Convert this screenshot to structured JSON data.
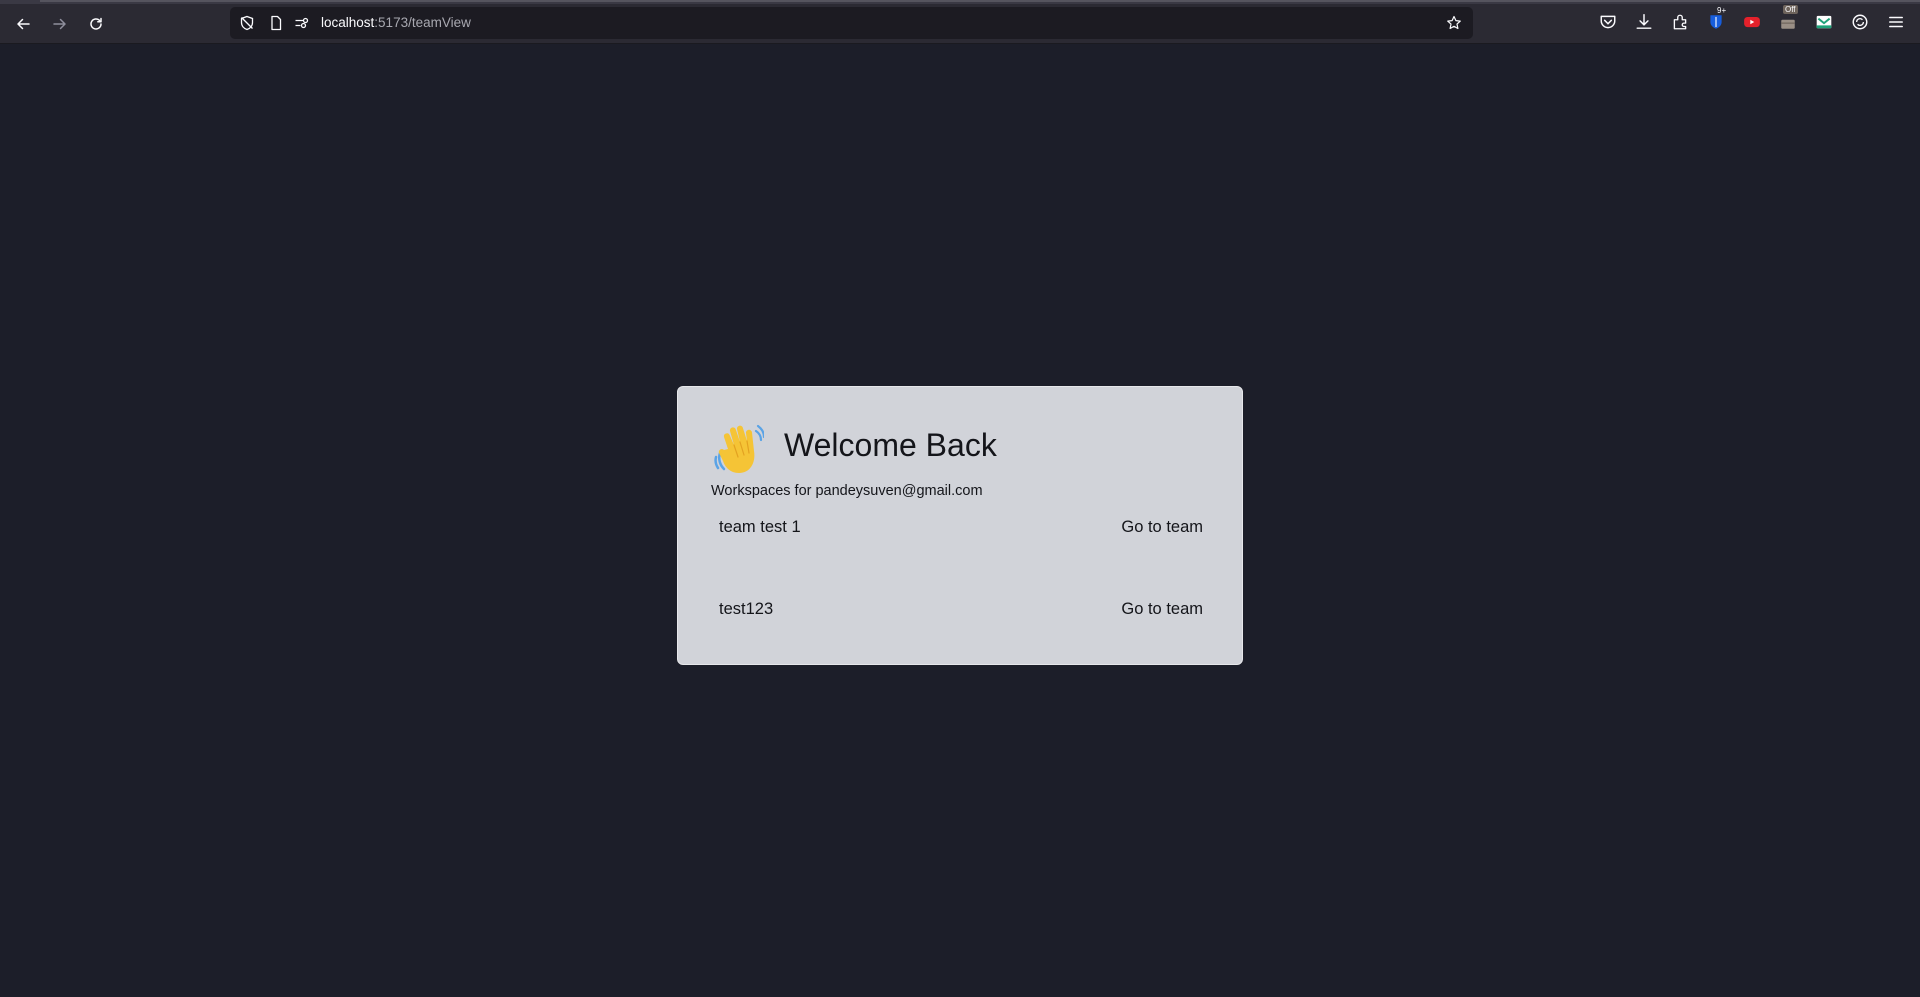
{
  "browser": {
    "url_host": "localhost",
    "url_path": ":5173/teamView",
    "icons": [
      "back-icon",
      "forward-icon",
      "reload-icon",
      "tracking-protection-icon",
      "page-info-icon",
      "permissions-icon",
      "bookmark-star-icon",
      "pocket-icon",
      "downloads-icon",
      "extensions-icon",
      "bitwarden-icon",
      "youtube-extension-icon",
      "extension-off-icon",
      "mail-extension-icon",
      "sync-icon",
      "menu-icon"
    ],
    "badges": {
      "bitwarden": "9+",
      "extension_off": "Off"
    }
  },
  "card": {
    "title": "Welcome Back",
    "subtitle": "Workspaces for pandeysuven@gmail.com",
    "teams": [
      {
        "name": "team test 1",
        "action": "Go to team"
      },
      {
        "name": "test123",
        "action": "Go to team"
      }
    ]
  },
  "colors": {
    "page_bg": "#1c1e29",
    "card_bg": "#d1d3d9",
    "chrome_bg": "#2b2a33",
    "urlbar_bg": "#1c1b22"
  }
}
